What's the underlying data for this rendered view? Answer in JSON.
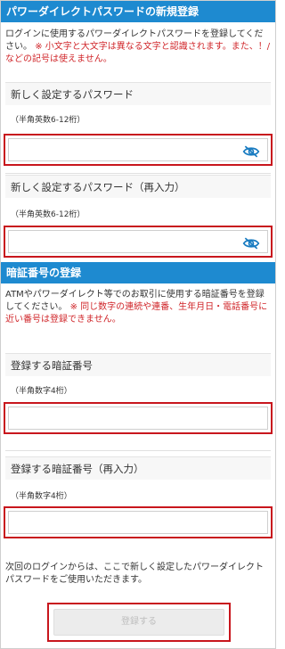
{
  "password_section": {
    "title": "パワーダイレクトパスワードの新規登録",
    "description": "ログインに使用するパワーダイレクトパスワードを登録してください。",
    "warning": "※ 小文字と大文字は異なる文字と認識されます。また、！/ などの記号は使えません。",
    "new_password": {
      "label": "新しく設定するパスワード",
      "hint": "（半角英数6-12桁）",
      "value": "",
      "icon": "eye-slash-icon"
    },
    "confirm_password": {
      "label": "新しく設定するパスワード（再入力）",
      "hint": "（半角英数6-12桁）",
      "value": "",
      "icon": "eye-slash-icon"
    }
  },
  "pin_section": {
    "title": "暗証番号の登録",
    "description": "ATMやパワーダイレクト等でのお取引に使用する暗証番号を登録してください。",
    "warning": "※ 同じ数字の連続や連番、生年月日・電話番号に近い番号は登録できません。",
    "pin": {
      "label": "登録する暗証番号",
      "hint": "（半角数字4桁）",
      "value": ""
    },
    "confirm_pin": {
      "label": "登録する暗証番号（再入力）",
      "hint": "（半角数字4桁）",
      "value": ""
    }
  },
  "footer": {
    "note": "次回のログインからは、ここで新しく設定したパワーダイレクトパスワードをご使用いただきます。",
    "submit_label": "登録する"
  },
  "colors": {
    "header": "#1e8ad0",
    "warning": "#d0262a",
    "highlight_border": "#c8161d",
    "icon": "#1a7cc1"
  }
}
